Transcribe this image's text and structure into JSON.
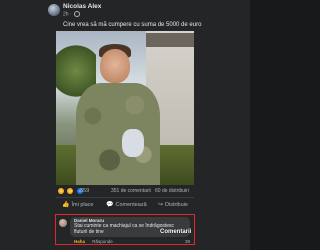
{
  "post": {
    "author": "Nicolas Alex",
    "time": "2h",
    "caption": "Cine vrea să mă cumpere cu suma de 5000 de euro",
    "reactions": {
      "count": "359",
      "icons": [
        "haha-icon",
        "wow-icon",
        "like-icon"
      ]
    },
    "comments_count": "351 de comentarii",
    "shares_count": "60 de distribuiri"
  },
  "actions": {
    "like": "Îmi place",
    "comment": "Comentează",
    "share": "Distribuie"
  },
  "comment": {
    "author": "Daniel Moraru",
    "text": "Stai cuminte ca machiajul ca se îndrăgostesc fluturii de tine",
    "reaction": "Haha",
    "reply": "Răspunde",
    "count": "39",
    "watermark": "Comentarii"
  },
  "colors": {
    "background": "#242526",
    "highlight_border": "#e3262b",
    "haha": "#f7b125",
    "like": "#1877f2"
  }
}
